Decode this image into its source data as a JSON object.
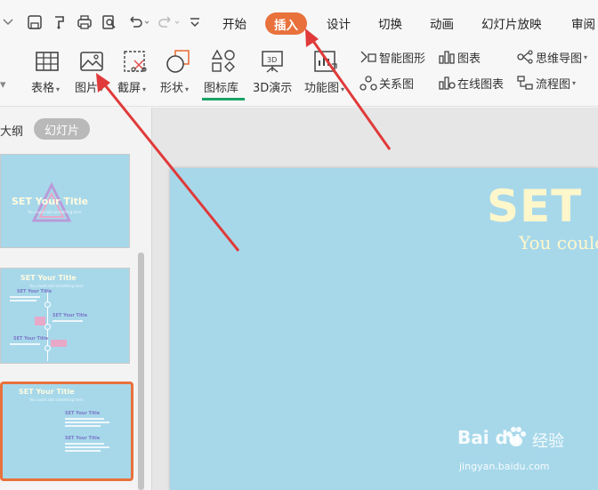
{
  "tabs": [
    "开始",
    "插入",
    "设计",
    "切换",
    "动画",
    "幻灯片放映",
    "审阅"
  ],
  "active_tab": "插入",
  "ribbon": {
    "table": "表格",
    "picture": "图片",
    "screenshot": "截屏",
    "shape": "形状",
    "icon_lib": "图标库",
    "demo3d": "3D演示",
    "func_chart": "功能图",
    "smart_art": "智能图形",
    "chart": "图表",
    "mind_map": "思维导图",
    "relation": "关系图",
    "online_chart": "在线图表",
    "flow_chart": "流程图"
  },
  "panel": {
    "outline_tab": "大纲",
    "slides_tab": "幻灯片"
  },
  "thumbnails": [
    {
      "title": "SET Your Title",
      "subtitle": "You could add something here"
    },
    {
      "title": "SET Your Title",
      "subtitle": "You could add something here",
      "items": [
        "SET Your Title",
        "SET Your Title",
        "SET Your Title"
      ]
    },
    {
      "title": "SET Your Title",
      "subtitle": "You could add something here",
      "items": [
        "SET Your Title",
        "SET Your Title"
      ]
    }
  ],
  "slide": {
    "title": "SET Y",
    "subtitle": "You could"
  },
  "watermark": {
    "logo": "Bai  du",
    "suffix": "经验",
    "url": "jingyan.baidu.com"
  },
  "colors": {
    "accent": "#e8713c",
    "slide_bg": "#a7d8ea",
    "title_text": "#fff7cc",
    "arrow": "#e03a3a",
    "active_underline": "#1aa366"
  }
}
